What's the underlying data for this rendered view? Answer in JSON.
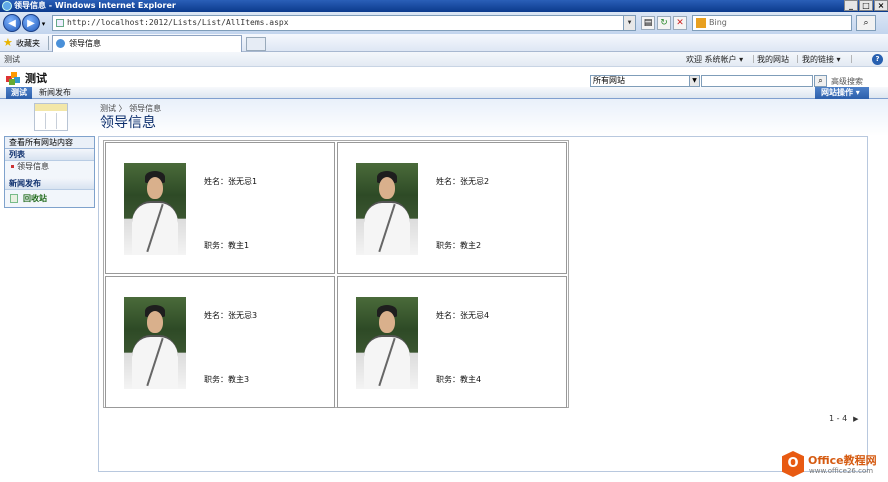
{
  "window": {
    "title": "领导信息 - Windows Internet Explorer"
  },
  "browser": {
    "address": "http://localhost:2012/Lists/List/AllItems.aspx",
    "search_provider": "Bing",
    "favorites_label": "收藏夹",
    "tab_title": "领导信息"
  },
  "global_nav": {
    "site_name": "测试",
    "welcome": "欢迎 系统帐户 ▾",
    "my_site": "我的网站",
    "my_links": "我的链接 ▾"
  },
  "title_area": {
    "site_title": "测试",
    "search_scope": "所有网站",
    "advanced_search": "高级搜索"
  },
  "top_nav": {
    "tabs": [
      {
        "label": "测试",
        "selected": true
      },
      {
        "label": "新闻发布",
        "selected": false
      }
    ],
    "site_actions": "网站操作 ▾"
  },
  "page": {
    "breadcrumb": "测试 〉 领导信息",
    "title": "领导信息"
  },
  "left_nav": {
    "view_all": "查看所有网站内容",
    "sections": [
      {
        "heading": "列表",
        "items": [
          "领导信息"
        ]
      },
      {
        "heading": "新闻发布",
        "items": []
      }
    ],
    "recycle_bin": "回收站"
  },
  "cards": [
    {
      "name": "姓名：张无忌1",
      "title": "职务：教主1"
    },
    {
      "name": "姓名：张无忌2",
      "title": "职务：教主2"
    },
    {
      "name": "姓名：张无忌3",
      "title": "职务：教主3"
    },
    {
      "name": "姓名：张无忌4",
      "title": "职务：教主4"
    }
  ],
  "paging": "1 - 4",
  "watermark": {
    "brand": "Office教程网",
    "url": "www.office26.com"
  }
}
